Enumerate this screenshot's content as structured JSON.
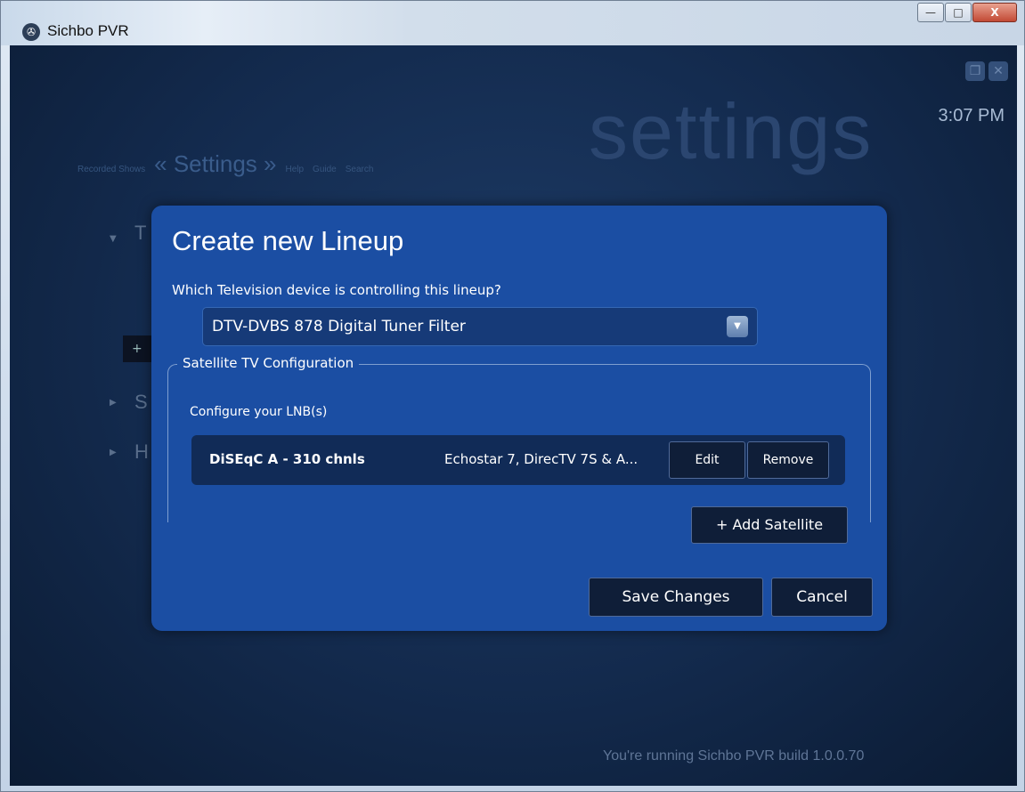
{
  "window": {
    "title": "Sichbo PVR",
    "controls": {
      "minimize": "—",
      "maximize": "□",
      "close": "X"
    }
  },
  "background": {
    "settings_watermark": "settings",
    "clock": "3:07 PM",
    "nav": {
      "recorded": "Recorded Shows",
      "current": "« Settings »",
      "help": "Help",
      "guide": "Guide",
      "search": "Search"
    },
    "side": {
      "t": "T",
      "s": "S",
      "h": "H",
      "plus": "+"
    },
    "build_text": "You're running Sichbo PVR build 1.0.0.70"
  },
  "dialog": {
    "title": "Create new Lineup",
    "question": "Which Television device is controlling this lineup?",
    "device_selected": "DTV-DVBS 878 Digital Tuner Filter",
    "satellite_legend": "Satellite TV Configuration",
    "lnb_label": "Configure your LNB(s)",
    "lnb_rows": [
      {
        "name": "DiSEqC A - 310 chnls",
        "satellites": "Echostar 7, DirecTV 7S & A...",
        "edit_label": "Edit",
        "remove_label": "Remove"
      }
    ],
    "add_satellite_label": "+ Add Satellite",
    "save_label": "Save Changes",
    "cancel_label": "Cancel"
  },
  "colors": {
    "dialog_bg": "#1b4ea3",
    "client_bg": "#132a4d",
    "button_bg": "#0f1e38"
  }
}
